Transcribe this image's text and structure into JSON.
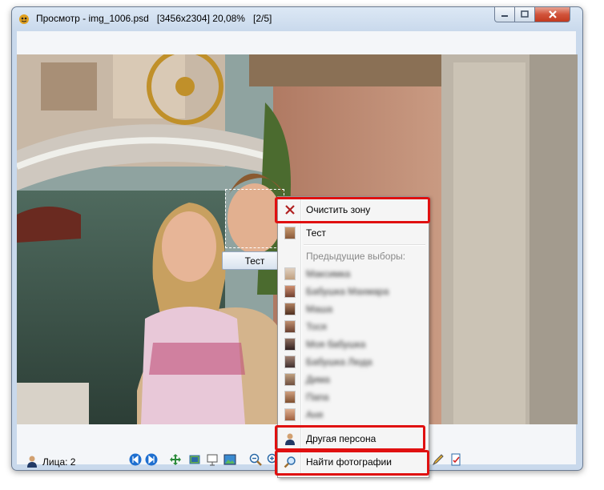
{
  "window": {
    "title": "Просмотр - img_1006.psd",
    "dimensions": "[3456x2304]",
    "zoom": "20,08%",
    "position": "[2/5]"
  },
  "photo": {
    "face_tag": "Тест"
  },
  "context_menu": {
    "clear_zone": "Очистить зону",
    "current_person": "Тест",
    "previous_header": "Предыдущие выборы:",
    "previous_items": [
      "Максимка",
      "Бабушка Махмара",
      "Маша",
      "Тося",
      "Моя бабушка",
      "Бабушка Люда",
      "Дима",
      "Папа",
      "Аня"
    ],
    "other_person": "Другая персона",
    "find_photos": "Найти фотографии"
  },
  "status": {
    "faces_label": "Лица: 2"
  },
  "colors": {
    "highlight": "#e01010",
    "title_bar": "#c9d9ec",
    "menu_bg": "#f5f5f5"
  }
}
